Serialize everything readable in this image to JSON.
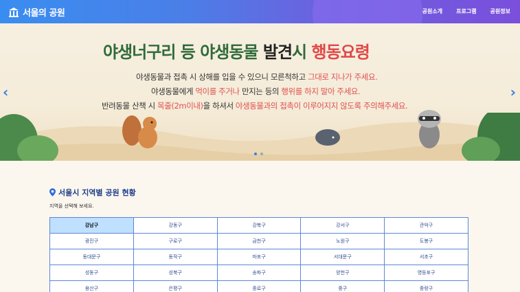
{
  "header": {
    "title": "서울의 공원",
    "nav": [
      "공원소개",
      "프로그램",
      "공원정보"
    ],
    "colors": {
      "start": "#3a8df0",
      "end": "#7a4fdc"
    }
  },
  "banner": {
    "headline": {
      "part1": "야생너구리 등 야생동물 ",
      "part2": "발견",
      "part3": "시 ",
      "part4": "행동요령"
    },
    "line1": {
      "a": "야생동물과 접촉 시 상해를 입을 수 있으니 모른척하고 ",
      "b": "그대로 지나가 주세요."
    },
    "line2": {
      "a": "야생동물에게 ",
      "b": "먹이를 주거나",
      "c": " 만지는 등의 ",
      "d": "행위를 하지 말아 주세요."
    },
    "line3": {
      "a": "반려동물 산책 시 ",
      "b": "목줄(2m이내)",
      "c": "을 하셔서 ",
      "d": "야생동물과의 접촉이 이루어지지 않도록 주의해주세요."
    },
    "slides": 2,
    "active_slide": 1
  },
  "region": {
    "title": "서울시 지역별 공원 현황",
    "subtitle": "지역을 선택해 보세요.",
    "selected": "강남구",
    "rows": [
      [
        "강남구",
        "강동구",
        "강북구",
        "강서구",
        "관악구"
      ],
      [
        "광진구",
        "구로구",
        "금천구",
        "노원구",
        "도봉구"
      ],
      [
        "동대문구",
        "동작구",
        "마포구",
        "서대문구",
        "서초구"
      ],
      [
        "성동구",
        "성북구",
        "송파구",
        "양천구",
        "영등포구"
      ],
      [
        "용산구",
        "은평구",
        "종로구",
        "중구",
        "중랑구"
      ]
    ]
  }
}
